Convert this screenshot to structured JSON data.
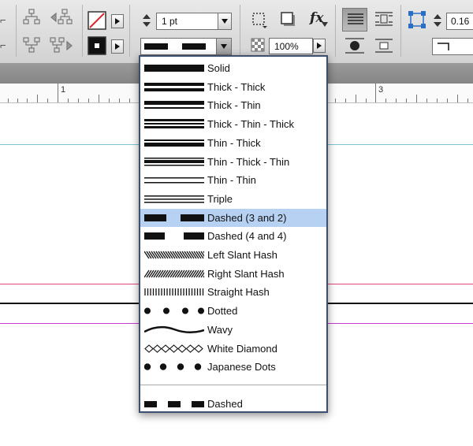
{
  "toolbar": {
    "stroke_weight_value": "1 pt",
    "zoom_value": "100%",
    "fx_label": "fx",
    "corner_value": "0.16"
  },
  "ruler": {
    "marks": [
      "1",
      "3"
    ]
  },
  "stroke_type_menu": {
    "items": [
      {
        "label": "Solid",
        "style": "solid",
        "selected": false
      },
      {
        "label": "Thick - Thick",
        "style": "thick-thick",
        "selected": false
      },
      {
        "label": "Thick - Thin",
        "style": "thick-thin",
        "selected": false
      },
      {
        "label": "Thick - Thin - Thick",
        "style": "thick-thin-thick",
        "selected": false
      },
      {
        "label": "Thin - Thick",
        "style": "thin-thick",
        "selected": false
      },
      {
        "label": "Thin - Thick - Thin",
        "style": "thin-thick-thin",
        "selected": false
      },
      {
        "label": "Thin - Thin",
        "style": "thin-thin",
        "selected": false
      },
      {
        "label": "Triple",
        "style": "triple",
        "selected": false
      },
      {
        "label": "Dashed (3 and 2)",
        "style": "dashed-3-2",
        "selected": true
      },
      {
        "label": "Dashed (4 and 4)",
        "style": "dashed-4-4",
        "selected": false
      },
      {
        "label": "Left Slant Hash",
        "style": "left-slant-hash",
        "selected": false
      },
      {
        "label": "Right Slant Hash",
        "style": "right-slant-hash",
        "selected": false
      },
      {
        "label": "Straight Hash",
        "style": "straight-hash",
        "selected": false
      },
      {
        "label": "Dotted",
        "style": "dotted",
        "selected": false
      },
      {
        "label": "Wavy",
        "style": "wavy",
        "selected": false
      },
      {
        "label": "White Diamond",
        "style": "white-diamond",
        "selected": false
      },
      {
        "label": "Japanese Dots",
        "style": "japanese-dots",
        "selected": false
      }
    ],
    "custom_items": [
      {
        "label": "Dashed",
        "style": "dashed-custom",
        "selected": false
      }
    ]
  },
  "colors": {
    "selection": "#b6d1f2",
    "menu_border": "#3d4f6e",
    "guide_cyan": "#7fc4d3",
    "guide_red": "#e0457a",
    "guide_magenta": "#c73ad1"
  }
}
